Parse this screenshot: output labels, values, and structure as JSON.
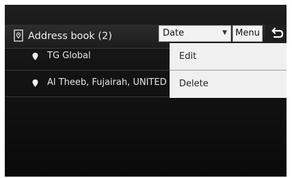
{
  "header": {
    "title": "Address book (2)",
    "sort_value": "Date",
    "menu_label": "Menu"
  },
  "addresses": [
    "TG Global",
    "Al Theeb, Fujairah, UNITED ARAB EMIRATES"
  ],
  "popup_menu": {
    "items": [
      "Edit",
      "Delete"
    ]
  }
}
